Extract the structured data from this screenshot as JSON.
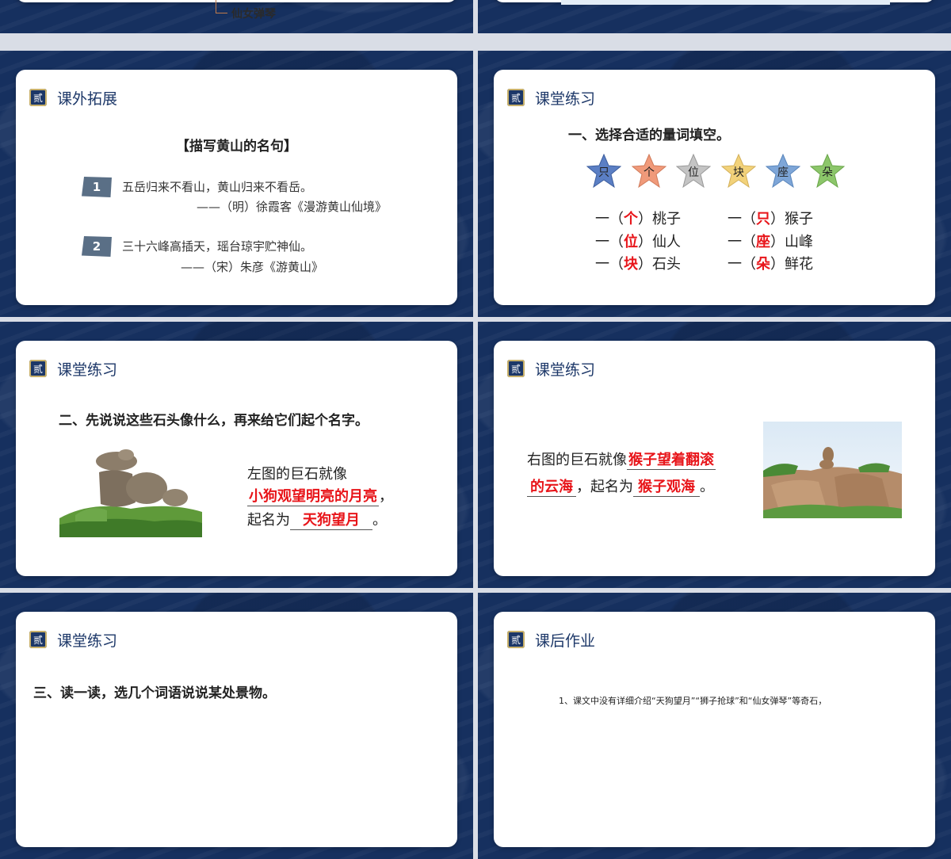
{
  "slide1": {
    "tree_item": "仙女弹琴"
  },
  "slide3": {
    "badge": "贰",
    "title": "课外拓展",
    "heading": "【描写黄山的名句】",
    "quotes": [
      {
        "num": "1",
        "line": "五岳归来不看山，黄山归来不看岳。",
        "source": "——（明）徐霞客《漫游黄山仙境》"
      },
      {
        "num": "2",
        "line": "三十六峰高插天，瑶台琼宇贮神仙。",
        "source": "——（宋）朱彦《游黄山》"
      }
    ]
  },
  "slide4": {
    "badge": "贰",
    "title": "课堂练习",
    "question": "一、选择合适的量词填空。",
    "stars": [
      {
        "char": "只",
        "color": "#5b7fc4"
      },
      {
        "char": "个",
        "color": "#f09a7a"
      },
      {
        "char": "位",
        "color": "#b0b0b0"
      },
      {
        "char": "块",
        "color": "#f2d27a"
      },
      {
        "char": "座",
        "color": "#7ea6d8"
      },
      {
        "char": "朵",
        "color": "#8cc66a"
      }
    ],
    "rows": [
      {
        "a_pre": "一（",
        "a_ans": "个",
        "a_post": "）桃子",
        "b_pre": "一（",
        "b_ans": "只",
        "b_post": "）猴子"
      },
      {
        "a_pre": "一（",
        "a_ans": "位",
        "a_post": "）仙人",
        "b_pre": "一（",
        "b_ans": "座",
        "b_post": "）山峰"
      },
      {
        "a_pre": "一（",
        "a_ans": "块",
        "a_post": "）石头",
        "b_pre": "一（",
        "b_ans": "朵",
        "b_post": "）鲜花"
      }
    ]
  },
  "slide5": {
    "badge": "贰",
    "title": "课堂练习",
    "question": "二、先说说这些石头像什么，再来给它们起个名字。",
    "text1": "左图的巨石就像",
    "answer1": "小狗观望明亮的月亮",
    "comma": "，",
    "text2": "起名为",
    "answer2": "天狗望月",
    "period": "。"
  },
  "slide6": {
    "badge": "贰",
    "title": "课堂练习",
    "text1": "右图的巨石就像",
    "answer1a": "猴子望着翻滚",
    "answer1b": "的云海",
    "text2": "，起名为",
    "answer2": "猴子观海",
    "period": "。"
  },
  "slide7": {
    "badge": "贰",
    "title": "课堂练习",
    "question": "三、读一读，选几个词语说说某处景物。"
  },
  "slide8": {
    "badge": "贰",
    "title": "课后作业",
    "text": "1、课文中没有详细介绍“天狗望月”“狮子抢球”和“仙女弹琴”等奇石，"
  }
}
